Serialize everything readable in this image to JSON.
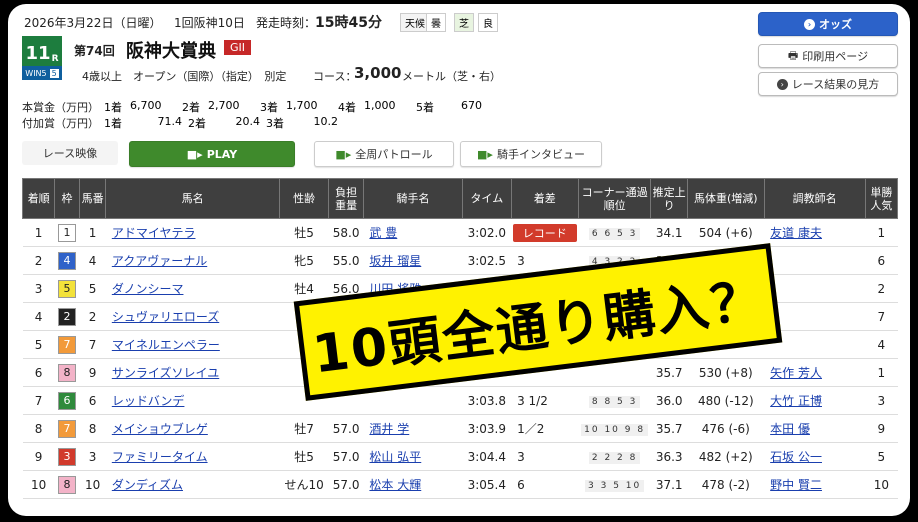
{
  "header": {
    "date": "2026年3月22日（日曜）",
    "meeting": "1回阪神10日",
    "post_time_label": "発走時刻：",
    "post_time": "15時45分",
    "weather_label": "天候",
    "weather": "曇",
    "track_label": "芝",
    "track_condition": "良",
    "race_number": "11",
    "race_number_suffix": "R",
    "badge_text": "WIN5",
    "badge_num": "5",
    "race_edition": "第74回",
    "race_name": "阪神大賞典",
    "grade": "GII",
    "conditions": "4歳以上　オープン（国際）（指定）　別定",
    "course_label": "コース：",
    "distance": "3,000",
    "distance_unit": "メートル（芝・右）"
  },
  "prize": {
    "main_label": "本賞金（万円）",
    "main": [
      [
        "1着",
        "6,700"
      ],
      [
        "2着",
        "2,700"
      ],
      [
        "3着",
        "1,700"
      ],
      [
        "4着",
        "1,000"
      ],
      [
        "5着",
        "670"
      ]
    ],
    "add_label": "付加賞（万円）",
    "add": [
      [
        "1着",
        "71.4"
      ],
      [
        "2着",
        "20.4"
      ],
      [
        "3着",
        "10.2"
      ]
    ]
  },
  "buttons": {
    "odds": "オッズ",
    "print": "印刷用ページ",
    "howto": "レース結果の見方",
    "race_video_label": "レース映像",
    "play": "PLAY",
    "patrol": "全周パトロール",
    "interview": "騎手インタビュー"
  },
  "table": {
    "headers": [
      "着順",
      "枠",
      "馬番",
      "馬名",
      "性齢",
      "負担重量",
      "騎手名",
      "タイム",
      "着差",
      "コーナー通過順位",
      "推定上り",
      "馬体重(増減)",
      "調教師名",
      "単勝人気"
    ],
    "rows": [
      {
        "pos": "1",
        "waku": "1",
        "num": "1",
        "name": "アドマイヤテラ",
        "sex_age": "牡5",
        "weight": "58.0",
        "jockey": "武 豊",
        "time": "3:02.0",
        "margin": "レコード",
        "corner": "6 6 5 3",
        "last3f": "34.1",
        "body": "504 (+6)",
        "trainer": "友道 康夫",
        "pop": "1"
      },
      {
        "pos": "2",
        "waku": "4",
        "num": "4",
        "name": "アクアヴァーナル",
        "sex_age": "牝5",
        "weight": "55.0",
        "jockey": "坂井 瑠星",
        "time": "3:02.5",
        "margin": "3",
        "corner": "4 3 2 2",
        "last3f": "34.9",
        "body": "478 (+4)",
        "trainer": "",
        "pop": "6"
      },
      {
        "pos": "3",
        "waku": "5",
        "num": "5",
        "name": "ダノンシーマ",
        "sex_age": "牡4",
        "weight": "56.0",
        "jockey": "川田 将雅",
        "time": "3:02.7",
        "margin": "",
        "corner": "",
        "last3f": "",
        "body": "",
        "trainer": "",
        "pop": "2"
      },
      {
        "pos": "4",
        "waku": "2",
        "num": "2",
        "name": "シュヴァリエローズ",
        "sex_age": "",
        "weight": "",
        "jockey": "",
        "time": "",
        "margin": "",
        "corner": "",
        "last3f": "",
        "body": "",
        "trainer": "",
        "pop": "7"
      },
      {
        "pos": "5",
        "waku": "7",
        "num": "7",
        "name": "マイネルエンペラー",
        "sex_age": "",
        "weight": "",
        "jockey": "",
        "time": "",
        "margin": "",
        "corner": "",
        "last3f": "",
        "body": "",
        "trainer": "",
        "pop": "4"
      },
      {
        "pos": "6",
        "waku": "8",
        "num": "9",
        "name": "サンライズソレイユ",
        "sex_age": "",
        "weight": "",
        "jockey": "",
        "time": "",
        "margin": "",
        "corner": "",
        "last3f": "35.7",
        "body": "530 (+8)",
        "trainer": "矢作 芳人",
        "pop": "1"
      },
      {
        "pos": "7",
        "waku": "6",
        "num": "6",
        "name": "レッドバンデ",
        "sex_age": "",
        "weight": "",
        "jockey": "",
        "time": "3:03.8",
        "margin": "3 1/2",
        "corner": "8 8 5 3",
        "last3f": "36.0",
        "body": "480 (-12)",
        "trainer": "大竹 正博",
        "pop": "3"
      },
      {
        "pos": "8",
        "waku": "7",
        "num": "8",
        "name": "メイショウブレゲ",
        "sex_age": "牡7",
        "weight": "57.0",
        "jockey": "酒井 学",
        "time": "3:03.9",
        "margin": "1／2",
        "corner": "10 10 9 8",
        "last3f": "35.7",
        "body": "476 (-6)",
        "trainer": "本田 優",
        "pop": "9"
      },
      {
        "pos": "9",
        "waku": "3",
        "num": "3",
        "name": "ファミリータイム",
        "sex_age": "牡5",
        "weight": "57.0",
        "jockey": "松山 弘平",
        "time": "3:04.4",
        "margin": "3",
        "corner": "2 2 2 8",
        "last3f": "36.3",
        "body": "482 (+2)",
        "trainer": "石坂 公一",
        "pop": "5"
      },
      {
        "pos": "10",
        "waku": "8",
        "num": "10",
        "name": "ダンディズム",
        "sex_age": "せん10",
        "weight": "57.0",
        "jockey": "松本 大輝",
        "time": "3:05.4",
        "margin": "6",
        "corner": "3 3 5 10",
        "last3f": "37.1",
        "body": "478 (-2)",
        "trainer": "野中 賢二",
        "pop": "10"
      }
    ]
  },
  "waku_colors": {
    "1": "#ffffff",
    "2": "#222222",
    "3": "#d13a2c",
    "4": "#2f62c9",
    "5": "#f3e23a",
    "6": "#2f8a3c",
    "7": "#f29a3a",
    "8": "#f3b3c8"
  },
  "overlay": {
    "text": "10頭全通り購入？"
  }
}
